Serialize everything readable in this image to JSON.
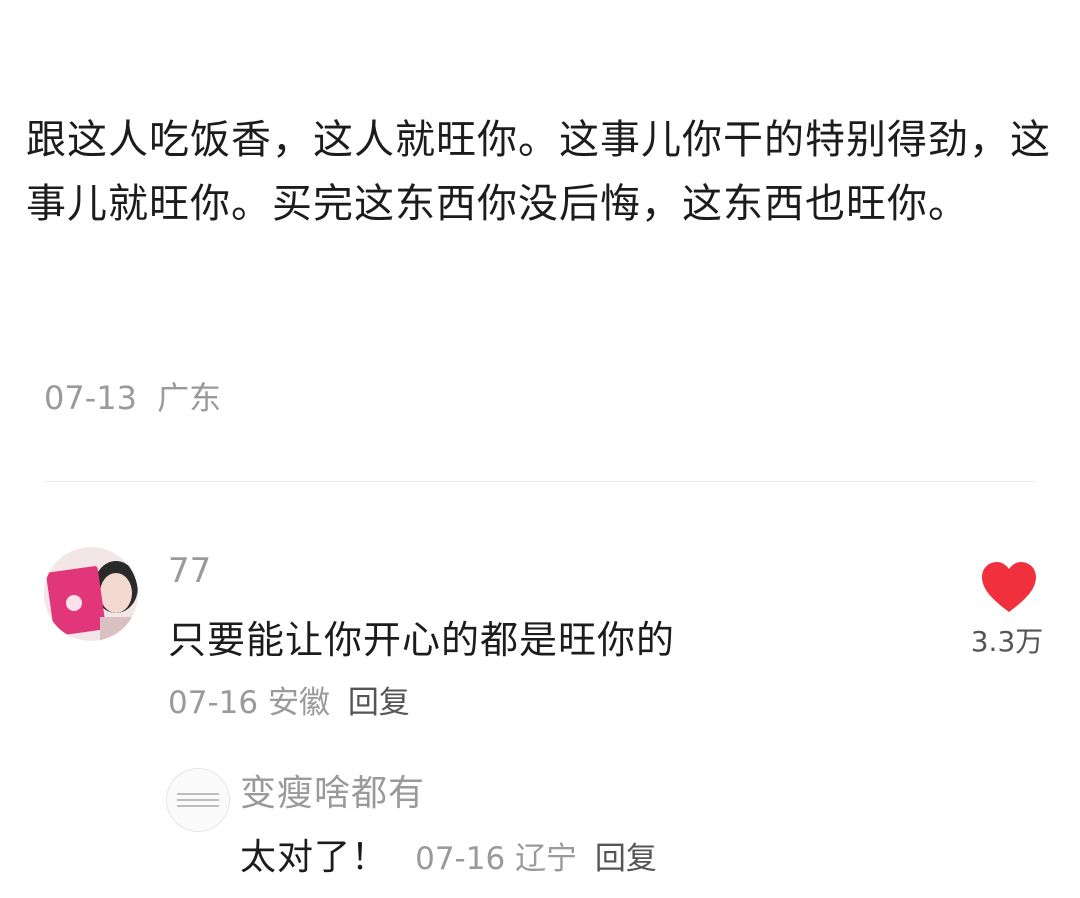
{
  "post": {
    "body": "跟这人吃饭香，这人就旺你。这事儿你干的特别得劲，这事儿就旺你。买完这东西你没后悔，这东西也旺你。",
    "date": "07-13",
    "location": "广东"
  },
  "comment": {
    "author": "77",
    "text": "只要能让你开心的都是旺你的",
    "date": "07-16",
    "location": "安徽",
    "reply_label": "回复",
    "like_count": "3.3万",
    "like_icon": "heart-icon",
    "like_color": "#f0313d"
  },
  "reply": {
    "author": "变瘦啥都有",
    "text": "太对了！",
    "date": "07-16",
    "location": "辽宁",
    "reply_label": "回复"
  },
  "colors": {
    "text_primary": "#1c1c1c",
    "text_secondary": "#9a9a9a",
    "divider": "#ececec"
  }
}
